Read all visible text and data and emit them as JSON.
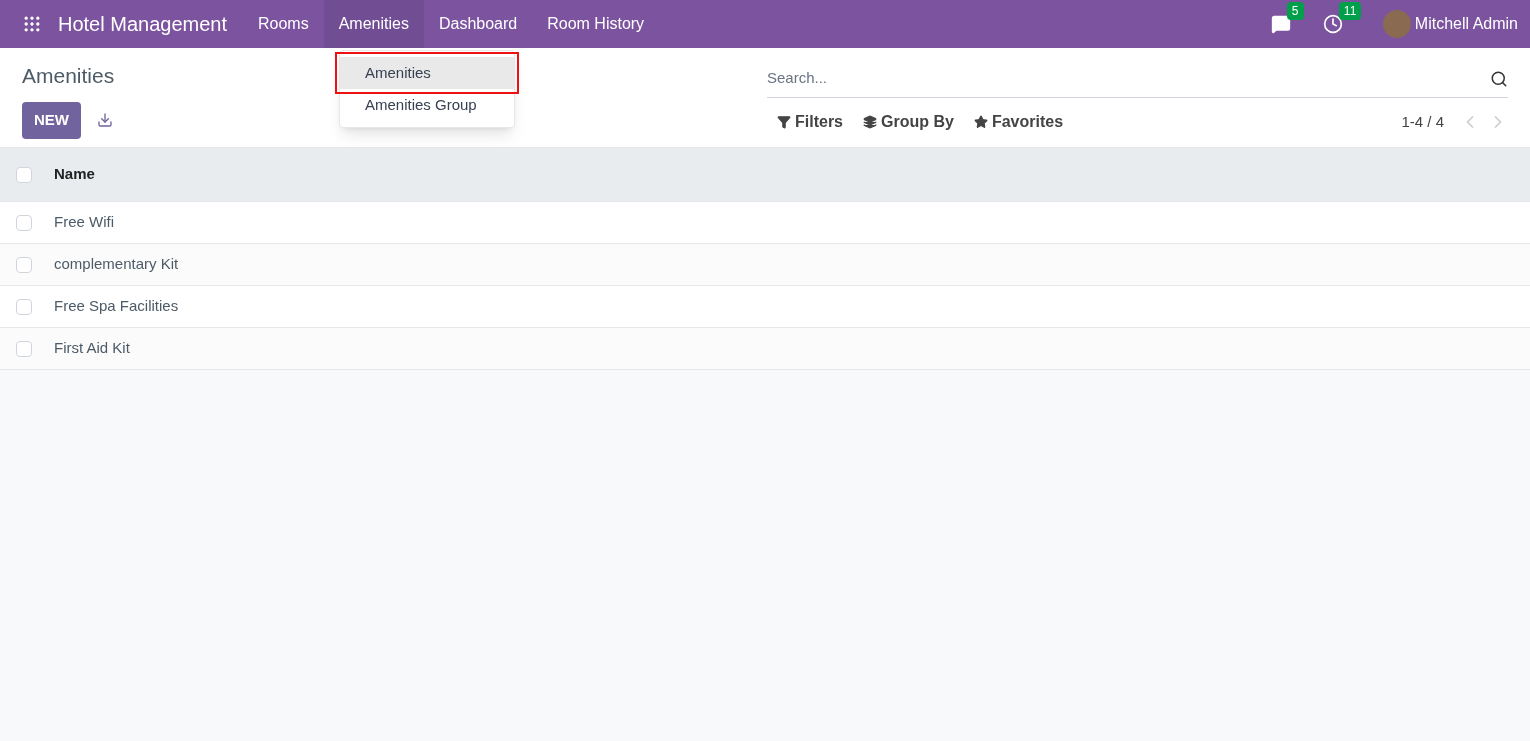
{
  "navbar": {
    "app_title": "Hotel Management",
    "menu": [
      {
        "label": "Rooms",
        "selected": false
      },
      {
        "label": "Amenities",
        "selected": true
      },
      {
        "label": "Dashboard",
        "selected": false
      },
      {
        "label": "Room History",
        "selected": false
      }
    ],
    "messages_count": "5",
    "activities_count": "11",
    "user": "Mitchell Admin"
  },
  "dropdown": {
    "items": [
      {
        "label": "Amenities",
        "selected": true,
        "highlighted": true
      },
      {
        "label": "Amenities Group",
        "selected": false,
        "highlighted": false
      }
    ]
  },
  "control_panel": {
    "title": "Amenities",
    "new_button": "NEW",
    "search": {
      "placeholder": "Search..."
    },
    "filters": [
      "Filters",
      "Group By",
      "Favorites"
    ],
    "pager": "1-4 / 4"
  },
  "table": {
    "columns": [
      "Name"
    ],
    "header_checked": false,
    "rows": [
      {
        "name": "Free Wifi",
        "checked": false
      },
      {
        "name": "complementary Kit",
        "checked": false
      },
      {
        "name": "Free Spa Facilities",
        "checked": false
      },
      {
        "name": "First Aid Kit",
        "checked": false
      }
    ]
  }
}
